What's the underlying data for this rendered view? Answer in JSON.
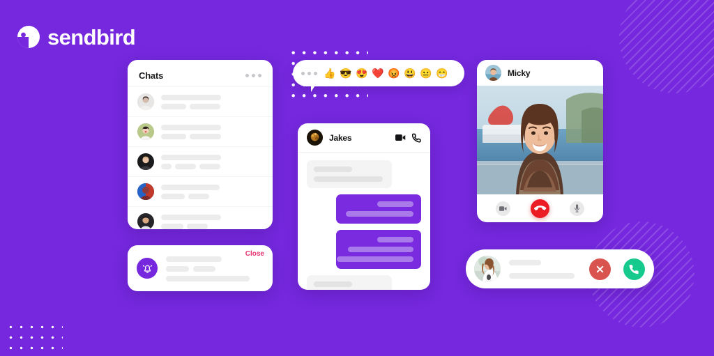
{
  "brand": {
    "name": "sendbird",
    "logo_icon": "sendbird-bubble-mark",
    "background_color": "#7528DE",
    "accent_color": "#7A2BE0"
  },
  "chats_panel": {
    "title": "Chats",
    "menu_icon": "ellipsis-horizontal-icon",
    "rows": [
      {
        "avatar_icon": "avatar-woman-1"
      },
      {
        "avatar_icon": "avatar-woman-2"
      },
      {
        "avatar_icon": "avatar-man-1"
      },
      {
        "avatar_icon": "avatar-art-portrait"
      },
      {
        "avatar_icon": "avatar-man-2"
      }
    ]
  },
  "notification_card": {
    "bell_icon": "alarm-bell-icon",
    "close_label": "Close",
    "close_color": "#E8336E"
  },
  "emoji_bar": {
    "more_icon": "ellipsis-horizontal-icon",
    "emojis": [
      {
        "name": "thumbs-up-emoji",
        "glyph": "👍"
      },
      {
        "name": "sunglasses-face-emoji",
        "glyph": "😎"
      },
      {
        "name": "heart-eyes-emoji",
        "glyph": "😍"
      },
      {
        "name": "red-heart-emoji",
        "glyph": "❤️"
      },
      {
        "name": "angry-face-emoji",
        "glyph": "😡"
      },
      {
        "name": "grinning-face-emoji",
        "glyph": "😃"
      },
      {
        "name": "neutral-face-emoji",
        "glyph": "😐"
      },
      {
        "name": "grinning-teeth-emoji",
        "glyph": "😁"
      }
    ]
  },
  "jakes_chat": {
    "name": "Jakes",
    "avatar_icon": "avatar-jakes",
    "video_icon": "video-camera-icon",
    "phone_icon": "phone-handset-icon",
    "messages": [
      {
        "direction": "incoming",
        "lines": 2
      },
      {
        "direction": "outgoing",
        "lines": 2
      },
      {
        "direction": "outgoing",
        "lines": 3
      },
      {
        "direction": "incoming",
        "lines": 2
      }
    ]
  },
  "video_call": {
    "name": "Micky",
    "avatar_icon": "avatar-micky",
    "feed_icon": "video-feed-woman-smiling",
    "controls": [
      {
        "name": "camera-toggle-button",
        "icon": "video-camera-icon",
        "color": "#E9E9EA"
      },
      {
        "name": "end-call-button",
        "icon": "end-call-handset-icon",
        "color": "#EC1C24"
      },
      {
        "name": "microphone-toggle-button",
        "icon": "microphone-icon",
        "color": "#E9E9EA"
      }
    ]
  },
  "incoming_call": {
    "avatar_icon": "avatar-caller-woman",
    "decline": {
      "name": "decline-call-button",
      "icon": "close-x-icon",
      "color": "#D9534F"
    },
    "accept": {
      "name": "accept-call-button",
      "icon": "phone-handset-icon",
      "color": "#16C98D"
    }
  }
}
